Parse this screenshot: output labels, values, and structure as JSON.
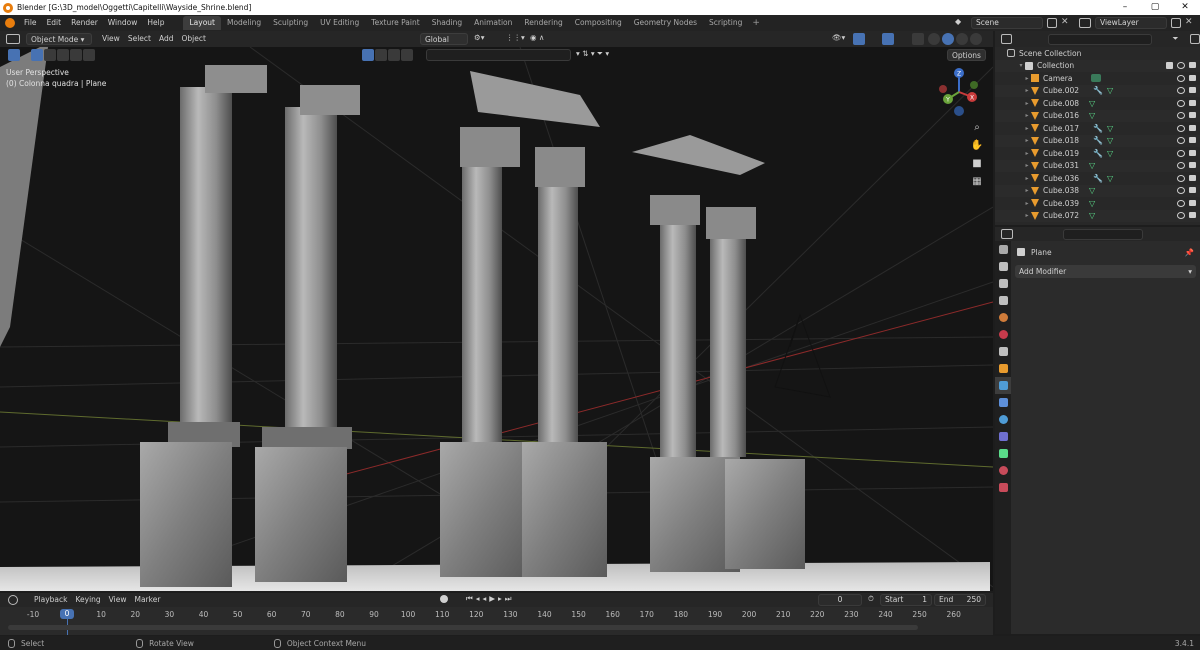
{
  "window": {
    "title": "Blender [G:\\3D_model\\Oggetti\\Capitelli\\Wayside_Shrine.blend]",
    "minimize": "–",
    "maximize": "▢",
    "close": "✕"
  },
  "menubar": {
    "items": [
      "File",
      "Edit",
      "Render",
      "Window",
      "Help"
    ]
  },
  "workspaces": [
    "Layout",
    "Modeling",
    "Sculpting",
    "UV Editing",
    "Texture Paint",
    "Shading",
    "Animation",
    "Rendering",
    "Compositing",
    "Geometry Nodes",
    "Scripting"
  ],
  "workspace_add": "+",
  "scene_field": "Scene",
  "viewlayer_field": "ViewLayer",
  "viewport": {
    "mode": "Object Mode",
    "menus": [
      "View",
      "Select",
      "Add",
      "Object"
    ],
    "orientation": "Global",
    "options": "Options",
    "overlay_line1": "User Perspective",
    "overlay_line2": "(0) Colonna quadra | Plane",
    "gizmo": {
      "x": "X",
      "y": "Y",
      "z": "Z"
    }
  },
  "outliner": {
    "scene_collection": "Scene Collection",
    "collection": "Collection",
    "rows": [
      {
        "name": "Camera",
        "type": "camera"
      },
      {
        "name": "Cube.002",
        "type": "mesh",
        "mod": true
      },
      {
        "name": "Cube.008",
        "type": "mesh",
        "mod": false
      },
      {
        "name": "Cube.016",
        "type": "mesh",
        "mod": false
      },
      {
        "name": "Cube.017",
        "type": "mesh",
        "mod": true
      },
      {
        "name": "Cube.018",
        "type": "mesh",
        "mod": true
      },
      {
        "name": "Cube.019",
        "type": "mesh",
        "mod": true
      },
      {
        "name": "Cube.031",
        "type": "mesh",
        "mod": false
      },
      {
        "name": "Cube.036",
        "type": "mesh",
        "mod": true
      },
      {
        "name": "Cube.038",
        "type": "mesh",
        "mod": false
      },
      {
        "name": "Cube.039",
        "type": "mesh",
        "mod": false
      },
      {
        "name": "Cube.072",
        "type": "mesh",
        "mod": false
      }
    ]
  },
  "properties": {
    "object_name": "Plane",
    "add_modifier": "Add Modifier"
  },
  "timeline": {
    "menus": [
      "Playback",
      "Keying",
      "View",
      "Marker"
    ],
    "current_frame": "0",
    "start_label": "Start",
    "start_value": "1",
    "end_label": "End",
    "end_value": "250",
    "ticks": [
      "-10",
      "0",
      "10",
      "20",
      "30",
      "40",
      "50",
      "60",
      "70",
      "80",
      "90",
      "100",
      "110",
      "120",
      "130",
      "140",
      "150",
      "160",
      "170",
      "180",
      "190",
      "200",
      "210",
      "220",
      "230",
      "240",
      "250",
      "260"
    ],
    "playhead_frame": "0"
  },
  "statusbar": {
    "select": "Select",
    "rotate": "Rotate View",
    "context": "Object Context Menu",
    "version": "3.4.1"
  }
}
